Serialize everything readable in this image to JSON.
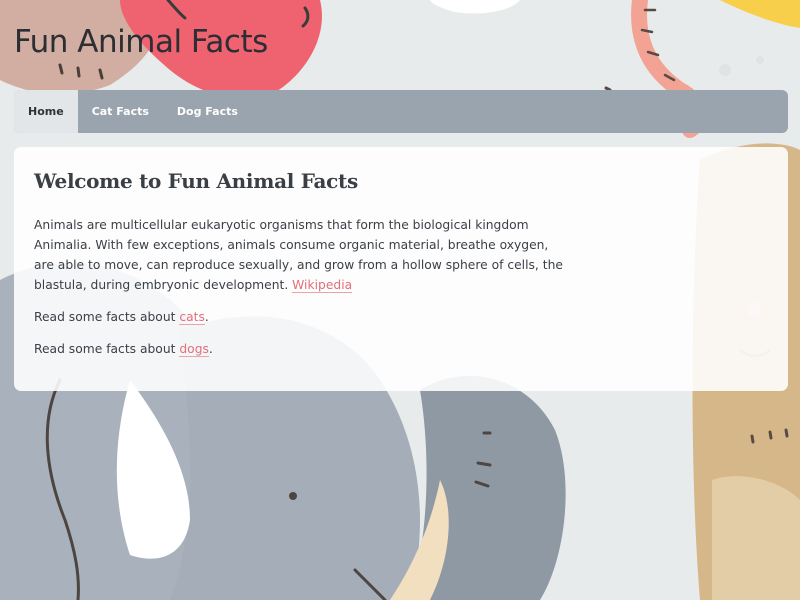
{
  "site": {
    "title": "Fun Animal Facts"
  },
  "nav": {
    "items": [
      {
        "label": "Home",
        "active": true
      },
      {
        "label": "Cat Facts",
        "active": false
      },
      {
        "label": "Dog Facts",
        "active": false
      }
    ]
  },
  "main": {
    "heading": "Welcome to Fun Animal Facts",
    "intro": "Animals are multicellular eukaryotic organisms that form the biological kingdom Animalia. With few exceptions, animals consume organic material, breathe oxygen, are able to move, can reproduce sexually, and grow from a hollow sphere of cells, the blastula, during embryonic development.",
    "wiki_link": "Wikipedia",
    "cats_prefix": "Read some facts about",
    "cats_link": "cats",
    "cats_suffix": ".",
    "dogs_prefix": "Read some facts about",
    "dogs_link": "dogs",
    "dogs_suffix": "."
  },
  "theme": {
    "accent": "#e06f78",
    "nav_bg": "#9aa4ae",
    "nav_active_bg": "#e2e6e9",
    "page_bg": "#e9ecec"
  }
}
